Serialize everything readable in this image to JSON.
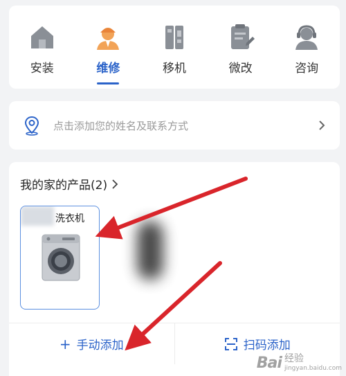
{
  "services": [
    {
      "label": "安装",
      "icon": "house-icon",
      "active": false
    },
    {
      "label": "维修",
      "icon": "repair-worker-icon",
      "active": true
    },
    {
      "label": "移机",
      "icon": "move-unit-icon",
      "active": false
    },
    {
      "label": "微改",
      "icon": "clipboard-edit-icon",
      "active": false
    },
    {
      "label": "咨询",
      "icon": "headset-agent-icon",
      "active": false
    }
  ],
  "contact": {
    "hint": "点击添加您的姓名及联系方式",
    "icon": "location-pin-icon"
  },
  "products": {
    "title": "我的家的产品(2)",
    "items": [
      {
        "name": "洗衣机",
        "icon": "washing-machine-icon"
      }
    ],
    "add_manual": "手动添加",
    "add_scan": "扫码添加"
  },
  "colors": {
    "accent": "#2b63c9",
    "annotation_arrow": "#d9252b",
    "background": "#f2f3f5"
  },
  "watermark": {
    "logo": "Bai",
    "name": "经验",
    "url": "jingyan.baidu.com"
  }
}
